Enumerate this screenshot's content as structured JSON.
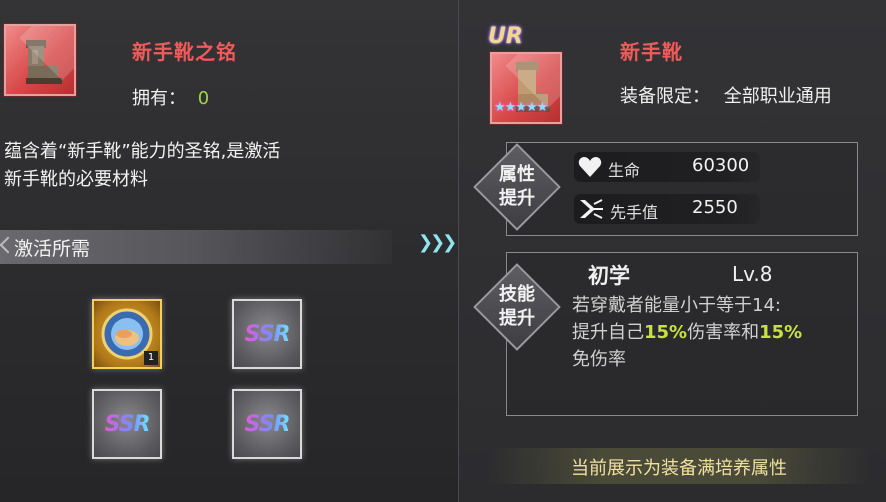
{
  "left": {
    "item_title": "新手靴之铭",
    "owned_label": "拥有：",
    "owned_count": "0",
    "description_line1": "蕴含着“新手靴”能力的圣铭,是激活",
    "description_line2": "新手靴的必要材料",
    "requirements_title": "激活所需",
    "slots": [
      {
        "kind": "gold-item",
        "count": "1"
      },
      {
        "kind": "ssr",
        "label": "SSR"
      },
      {
        "kind": "ssr",
        "label": "SSR"
      },
      {
        "kind": "ssr",
        "label": "SSR"
      }
    ]
  },
  "right": {
    "rarity_badge": "UR",
    "star_count": 5,
    "item_name": "新手靴",
    "restriction_label": "装备限定：",
    "restriction_value": "全部职业通用",
    "attr_section_line1": "属性",
    "attr_section_line2": "提升",
    "stats": [
      {
        "icon": "heart-icon",
        "name": "生命",
        "value": "60300"
      },
      {
        "icon": "speed-icon",
        "name": "先手值",
        "value": "2550"
      }
    ],
    "skill_section_line1": "技能",
    "skill_section_line2": "提升",
    "skill_name": "初学",
    "skill_level": "Lv.8",
    "skill_desc_line1": "若穿戴者能量小于等于14:",
    "skill_desc_line2_pre": "提升自己",
    "skill_desc_line2_hl1": "15%",
    "skill_desc_line2_mid": "伤害率和",
    "skill_desc_line2_hl2": "15%",
    "skill_desc_line3": "免伤率",
    "footer_note": "当前展示为装备满培养属性"
  },
  "colors": {
    "title_red": "#f05a5a",
    "green_value": "#9ed64a",
    "highlight_yellow": "#c8e040",
    "item_frame_red": "#d84848"
  }
}
